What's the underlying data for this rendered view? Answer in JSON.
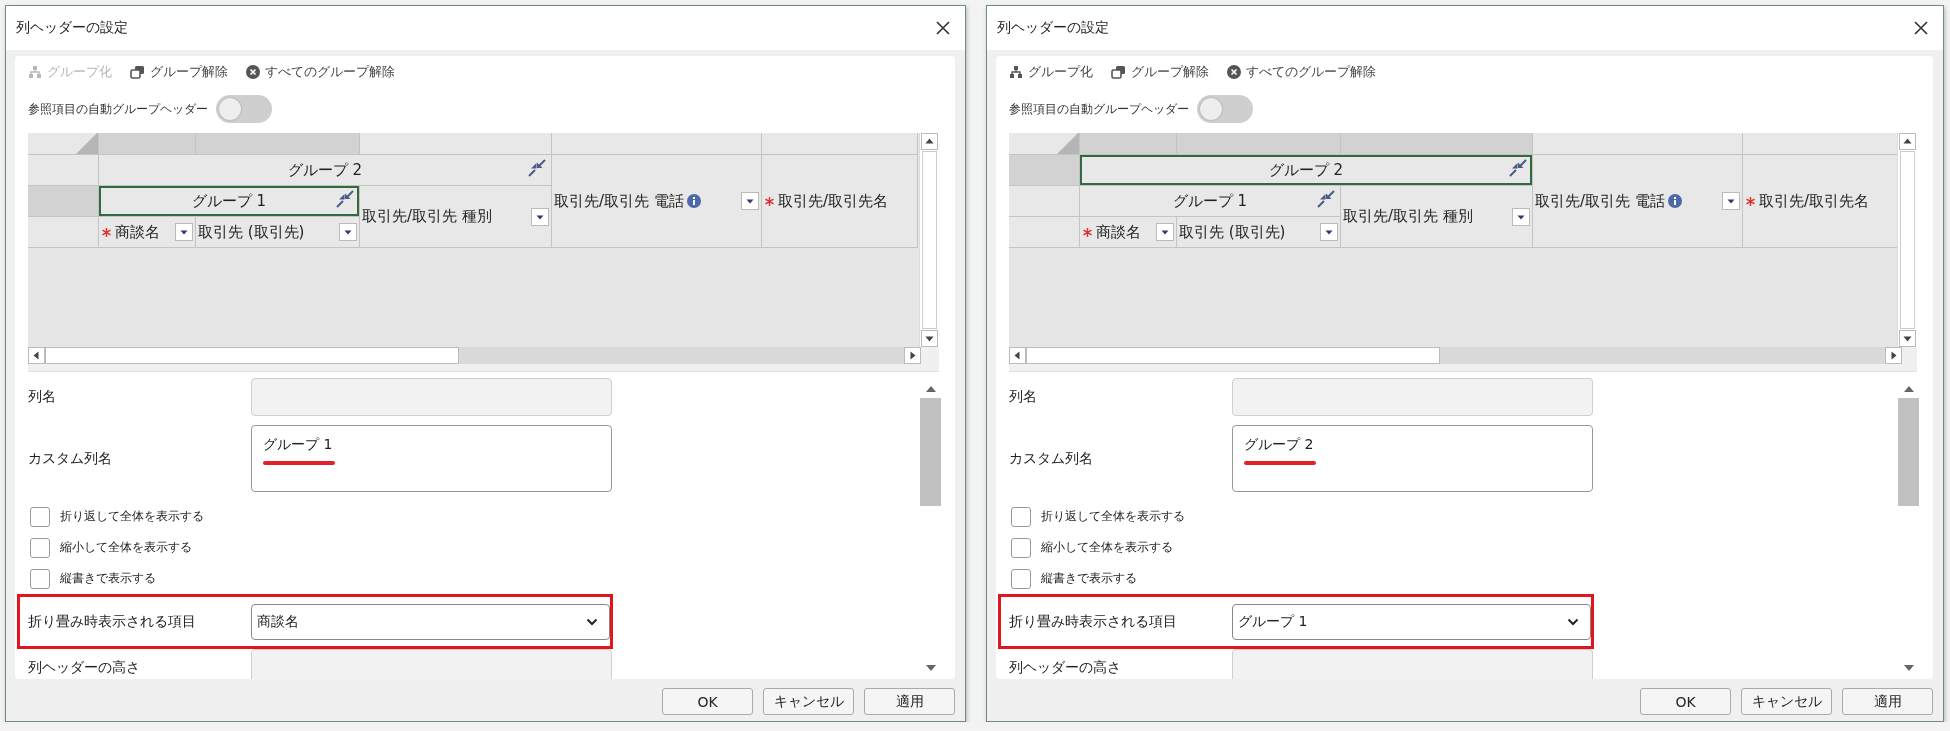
{
  "dialogs": [
    {
      "title": "列ヘッダーの設定",
      "toolbar": [
        {
          "kind": "group",
          "label": "グループ化",
          "disabled": true
        },
        {
          "kind": "ungroup",
          "label": "グループ解除",
          "disabled": false
        },
        {
          "kind": "clear",
          "label": "すべてのグループ解除",
          "disabled": false
        }
      ],
      "auto_group_header": {
        "label": "参照項目の自動グループヘッダー",
        "on": false
      },
      "header_tree": [
        {
          "label": "グループ 2",
          "selected": false,
          "children": [
            {
              "label": "グループ 1",
              "selected": true,
              "children": [
                {
                  "label": "商談名",
                  "required": true,
                  "dropdown": true,
                  "info": false
                },
                {
                  "label": "取引先 (取引先)",
                  "required": false,
                  "dropdown": true,
                  "info": false
                }
              ]
            },
            {
              "label": "取引先/取引先 種別",
              "required": false,
              "dropdown": true,
              "info": false
            }
          ]
        },
        {
          "label": "取引先/取引先 電話",
          "required": false,
          "dropdown": true,
          "info": true
        },
        {
          "label": "取引先/取引先名",
          "required": true,
          "dropdown": false,
          "info": false
        }
      ],
      "form": [
        {
          "kind": "text",
          "label": "列名",
          "disabled": true
        },
        {
          "kind": "textarea",
          "label": "カスタム列名",
          "value": "グループ 1",
          "underlined": true
        },
        {
          "kind": "checkbox",
          "label": "折り返して全体を表示する",
          "checked": false
        },
        {
          "kind": "checkbox",
          "label": "縮小して全体を表示する",
          "checked": false
        },
        {
          "kind": "checkbox",
          "label": "縦書きで表示する",
          "checked": false
        },
        {
          "kind": "select",
          "label": "折り畳み時表示される項目",
          "value": "商談名",
          "highlighted": true
        },
        {
          "kind": "text",
          "label": "列ヘッダーの高さ",
          "disabled": true
        }
      ],
      "buttons": [
        "OK",
        "キャンセル",
        "適用"
      ]
    },
    {
      "title": "列ヘッダーの設定",
      "toolbar": [
        {
          "kind": "group",
          "label": "グループ化",
          "disabled": false
        },
        {
          "kind": "ungroup",
          "label": "グループ解除",
          "disabled": false
        },
        {
          "kind": "clear",
          "label": "すべてのグループ解除",
          "disabled": false
        }
      ],
      "auto_group_header": {
        "label": "参照項目の自動グループヘッダー",
        "on": false
      },
      "header_tree": [
        {
          "label": "グループ 2",
          "selected": true,
          "children": [
            {
              "label": "グループ 1",
              "selected": false,
              "children": [
                {
                  "label": "商談名",
                  "required": true,
                  "dropdown": true,
                  "info": false
                },
                {
                  "label": "取引先 (取引先)",
                  "required": false,
                  "dropdown": true,
                  "info": false
                }
              ]
            },
            {
              "label": "取引先/取引先 種別",
              "required": false,
              "dropdown": true,
              "info": false
            }
          ]
        },
        {
          "label": "取引先/取引先 電話",
          "required": false,
          "dropdown": true,
          "info": true
        },
        {
          "label": "取引先/取引先名",
          "required": true,
          "dropdown": false,
          "info": false
        }
      ],
      "form": [
        {
          "kind": "text",
          "label": "列名",
          "disabled": true
        },
        {
          "kind": "textarea",
          "label": "カスタム列名",
          "value": "グループ 2",
          "underlined": true
        },
        {
          "kind": "checkbox",
          "label": "折り返して全体を表示する",
          "checked": false
        },
        {
          "kind": "checkbox",
          "label": "縮小して全体を表示する",
          "checked": false
        },
        {
          "kind": "checkbox",
          "label": "縦書きで表示する",
          "checked": false
        },
        {
          "kind": "select",
          "label": "折り畳み時表示される項目",
          "value": "グループ 1",
          "highlighted": true
        },
        {
          "kind": "text",
          "label": "列ヘッダーの高さ",
          "disabled": true
        }
      ],
      "buttons": [
        "OK",
        "キャンセル",
        "適用"
      ]
    }
  ]
}
